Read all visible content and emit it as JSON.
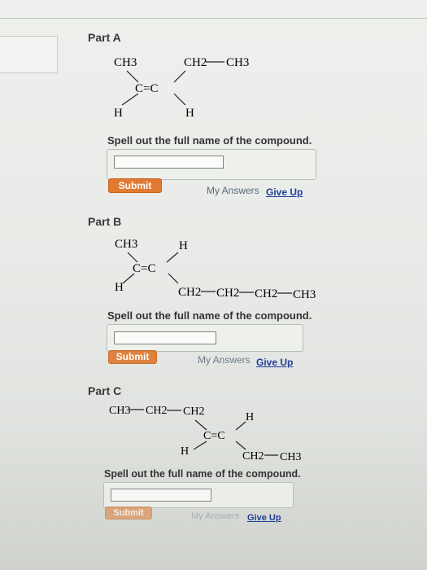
{
  "parts": [
    {
      "title": "Part A",
      "structure": {
        "top_left": "CH3",
        "top_right_1": "CH2",
        "top_right_2": "CH3",
        "double_bond": "C=C",
        "bottom_left": "H",
        "bottom_right": "H"
      },
      "prompt": "Spell out the full name of the compound.",
      "answer_value": "",
      "submit_label": "Submit",
      "my_answers_label": "My Answers",
      "give_up_label": "Give Up"
    },
    {
      "title": "Part B",
      "structure": {
        "top_left": "CH3",
        "top_right": "H",
        "double_bond": "C=C",
        "bottom_left": "H",
        "chain_1": "CH2",
        "chain_2": "CH2",
        "chain_3": "CH2",
        "chain_4": "CH3"
      },
      "prompt": "Spell out the full name of the compound.",
      "answer_value": "",
      "submit_label": "Submit",
      "my_answers_label": "My Answers",
      "give_up_label": "Give Up"
    },
    {
      "title": "Part C",
      "structure": {
        "chain_1": "CH3",
        "chain_2": "CH2",
        "chain_3": "CH2",
        "top_right": "H",
        "double_bond": "C=C",
        "bottom_left": "H",
        "bottom_right_1": "CH2",
        "bottom_right_2": "CH3"
      },
      "prompt": "Spell out the full name of the compound.",
      "answer_value": "",
      "submit_label": "Submit",
      "my_answers_label": "My Answers",
      "give_up_label": "Give Up"
    }
  ],
  "colors": {
    "submit": "#e07a32",
    "give_up_link": "#1f3f9a",
    "my_answers_link": "#5a6a7a"
  }
}
